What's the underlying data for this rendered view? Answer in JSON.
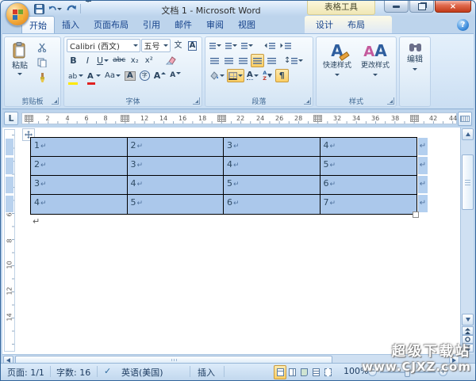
{
  "window": {
    "title": "文档 1 - Microsoft Word",
    "context_title": "表格工具",
    "close_glyph": "×",
    "help_glyph": "?"
  },
  "tabs": [
    "开始",
    "插入",
    "页面布局",
    "引用",
    "邮件",
    "审阅",
    "视图"
  ],
  "context_tabs": [
    "设计",
    "布局"
  ],
  "ribbon": {
    "clipboard": {
      "group_label": "剪贴板",
      "paste_label": "粘贴"
    },
    "font": {
      "group_label": "字体",
      "font_name": "Calibri (西文)",
      "font_size": "五号",
      "phonetic": "文",
      "char_border": "A",
      "bold": "B",
      "italic": "I",
      "underline": "U",
      "strikethrough": "abc",
      "subscript": "x₂",
      "superscript": "x²",
      "highlight": "ab",
      "font_color": "A",
      "change_case": "Aa",
      "char_shading": "A",
      "enclose": "字",
      "grow": "A",
      "shrink": "A"
    },
    "paragraph": {
      "group_label": "段落",
      "line_spacing": "↕",
      "sort_a": "A",
      "sort_z": "Z",
      "pilcrow": "¶",
      "asian": "A"
    },
    "styles": {
      "group_label": "样式",
      "quick_label": "快速样式",
      "quick_icon": "A",
      "change_label": "更改样式",
      "change_icon_1": "A",
      "change_icon_2": "A"
    },
    "editing": {
      "label": "编辑"
    }
  },
  "ruler": {
    "tab_selector": "L",
    "h_numbers": [
      "2",
      "4",
      "6",
      "8",
      "12",
      "14",
      "16",
      "18",
      "22",
      "24",
      "26",
      "28",
      "32",
      "34",
      "36",
      "38",
      "42",
      "44"
    ],
    "v_numbers": [
      "6",
      "8",
      "10",
      "12",
      "14"
    ]
  },
  "table": {
    "rows": [
      [
        "1",
        "2",
        "3",
        "4"
      ],
      [
        "2",
        "3",
        "4",
        "5"
      ],
      [
        "3",
        "4",
        "5",
        "6"
      ],
      [
        "4",
        "5",
        "6",
        "7"
      ]
    ],
    "cell_mark": "↵",
    "row_end_mark": "↵",
    "paragraph_mark": "↵"
  },
  "status": {
    "page": "页面: 1/1",
    "words": "字数: 16",
    "spell_glyph": "✓",
    "language": "英语(美国)",
    "insert_mode": "插入",
    "zoom": "100%",
    "zoom_out": "−",
    "zoom_in": "+"
  },
  "watermark": {
    "line1": "超级下载站",
    "line2": "www.CJXZ.com"
  },
  "colors": {
    "selection_blue": "#abc8eb",
    "active_orange": "#fbce63",
    "tab_text": "#15428b"
  }
}
